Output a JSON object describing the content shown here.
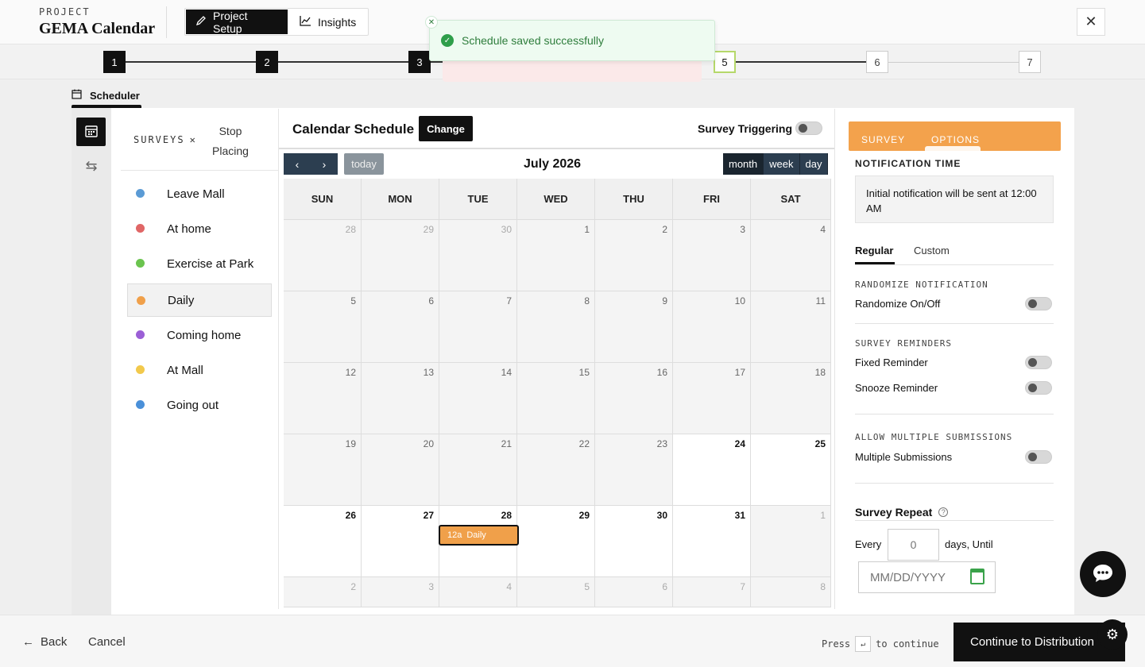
{
  "header": {
    "project_label": "PROJECT",
    "project_name": "GEMA Calendar",
    "tabs": [
      {
        "label": "Project Setup",
        "active": true
      },
      {
        "label": "Insights",
        "active": false
      }
    ],
    "close_icon": "close-icon"
  },
  "stepper": {
    "steps": [
      "1",
      "2",
      "3",
      "5",
      "6",
      "7"
    ],
    "current": "5"
  },
  "toast": {
    "message": "Schedule saved successfully"
  },
  "scheduler_tab": {
    "label": "Scheduler"
  },
  "surveys": {
    "title": "SURVEYS",
    "stop_placing": "Stop Placing",
    "items": [
      {
        "label": "Leave Mall",
        "color": "#5b9bd5"
      },
      {
        "label": "At home",
        "color": "#e06666"
      },
      {
        "label": "Exercise at Park",
        "color": "#6bc44f"
      },
      {
        "label": "Daily",
        "color": "#f0a04a",
        "selected": true
      },
      {
        "label": "Coming home",
        "color": "#9b5fd6"
      },
      {
        "label": "At Mall",
        "color": "#f2c94c"
      },
      {
        "label": "Going out",
        "color": "#4a90d9"
      }
    ]
  },
  "calendar": {
    "title": "Calendar Schedule",
    "change_label": "Change",
    "triggering_label": "Survey Triggering",
    "prev": "‹",
    "next": "›",
    "today_label": "today",
    "month_title": "July 2026",
    "views": [
      "month",
      "week",
      "day"
    ],
    "days_of_week": [
      "SUN",
      "MON",
      "TUE",
      "WED",
      "THU",
      "FRI",
      "SAT"
    ],
    "weeks": [
      [
        "28",
        "29",
        "30",
        "1",
        "2",
        "3",
        "4"
      ],
      [
        "5",
        "6",
        "7",
        "8",
        "9",
        "10",
        "11"
      ],
      [
        "12",
        "13",
        "14",
        "15",
        "16",
        "17",
        "18"
      ],
      [
        "19",
        "20",
        "21",
        "22",
        "23",
        "24",
        "25"
      ],
      [
        "26",
        "27",
        "28",
        "29",
        "30",
        "31",
        "1"
      ],
      [
        "2",
        "3",
        "4",
        "5",
        "6",
        "7",
        "8"
      ]
    ],
    "event": {
      "time": "12a",
      "label": "Daily"
    }
  },
  "options": {
    "tabs": [
      "SURVEY",
      "OPTIONS"
    ],
    "notification_time_label": "NOTIFICATION TIME",
    "notification_text": "Initial notification will be sent at 12:00 AM",
    "subtabs": [
      "Regular",
      "Custom"
    ],
    "randomize_header": "RANDOMIZE NOTIFICATION",
    "randomize_label": "Randomize On/Off",
    "reminders_header": "SURVEY REMINDERS",
    "fixed_reminder": "Fixed Reminder",
    "snooze_reminder": "Snooze Reminder",
    "multiple_header": "ALLOW MULTIPLE SUBMISSIONS",
    "multiple_label": "Multiple Submissions",
    "repeat_label": "Survey Repeat",
    "every_label": "Every",
    "every_placeholder": "0",
    "until_label": "days, Until",
    "date_placeholder": "MM/DD/YYYY"
  },
  "footer": {
    "back_label": "Back",
    "cancel_label": "Cancel",
    "press_label": "Press",
    "enter_key": "↵",
    "to_continue": "to continue",
    "continue_label": "Continue to Distribution"
  }
}
